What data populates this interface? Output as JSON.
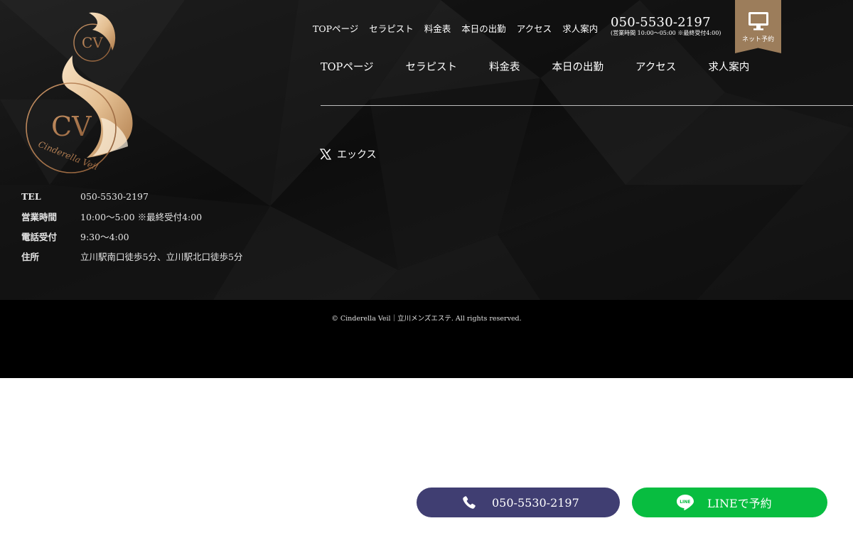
{
  "logo": {
    "monogram": "CV",
    "brand": "Cinderella Veil",
    "small_brand": "Cinderella Veil"
  },
  "info": [
    {
      "label": "TEL",
      "value": "050-5530-2197"
    },
    {
      "label": "営業時間",
      "value": "10:00～5:00 ※最終受付4:00"
    },
    {
      "label": "電話受付",
      "value": "9:30～4:00"
    },
    {
      "label": "住所",
      "value": "立川駅南口徒歩5分、立川駅北口徒歩5分"
    }
  ],
  "top_nav": [
    "TOPページ",
    "セラピスト",
    "料金表",
    "本日の出勤",
    "アクセス",
    "求人案内"
  ],
  "header_phone": {
    "number": "050-5530-2197",
    "hours": "(営業時間 10:00～05:00 ※最終受付4:00)"
  },
  "net_reserve": {
    "label": "ネット予約",
    "icon": "monitor-icon",
    "color": "#9c7d5b"
  },
  "main_nav": [
    "TOPページ",
    "セラピスト",
    "料金表",
    "本日の出勤",
    "アクセス",
    "求人案内"
  ],
  "social": {
    "label": "エックス",
    "icon": "x-logo-icon"
  },
  "copyright": "© Cinderella Veil｜立川メンズエステ. All rights reserved.",
  "cta": {
    "phone": {
      "label": "050-5530-2197",
      "icon": "phone-icon",
      "color": "#403e72"
    },
    "line": {
      "label": "LINEで予約",
      "icon": "line-icon",
      "color": "#08bd40"
    }
  }
}
